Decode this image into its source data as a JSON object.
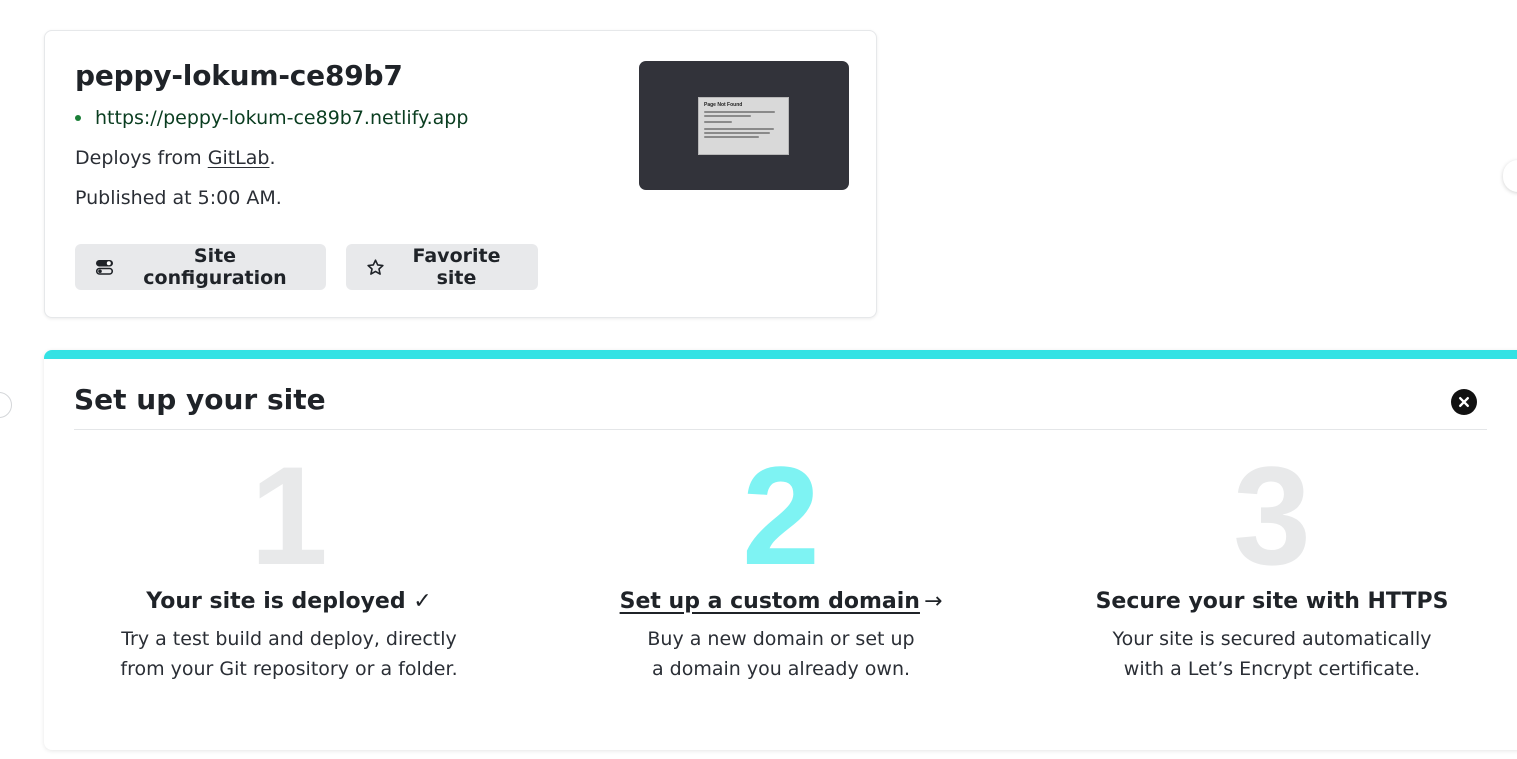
{
  "site": {
    "name": "peppy-lokum-ce89b7",
    "url": "https://peppy-lokum-ce89b7.netlify.app",
    "deploys_prefix": "Deploys from ",
    "deploys_source": "GitLab",
    "deploys_suffix": ".",
    "published": "Published at 5:00 AM.",
    "buttons": {
      "config_label": "Site configuration",
      "favorite_label": "Favorite site"
    },
    "preview": {
      "title": "Page Not Found"
    }
  },
  "setup": {
    "title": "Set up your site",
    "accent_color": "#34e2e4",
    "steps": [
      {
        "number": "1",
        "heading": "Your site is deployed ✓",
        "description": "Try a test build and deploy, directly\nfrom your Git repository or a folder."
      },
      {
        "number": "2",
        "heading": "Set up a custom domain",
        "heading_suffix": "→",
        "description": "Buy a new domain or set up\na domain you already own."
      },
      {
        "number": "3",
        "heading": "Secure your site with HTTPS",
        "description": "Your site is secured automatically\nwith a Let’s Encrypt certificate."
      }
    ]
  },
  "icons": {
    "config": "toggle-settings-icon",
    "favorite": "star-icon",
    "close": "close-circle-icon"
  }
}
